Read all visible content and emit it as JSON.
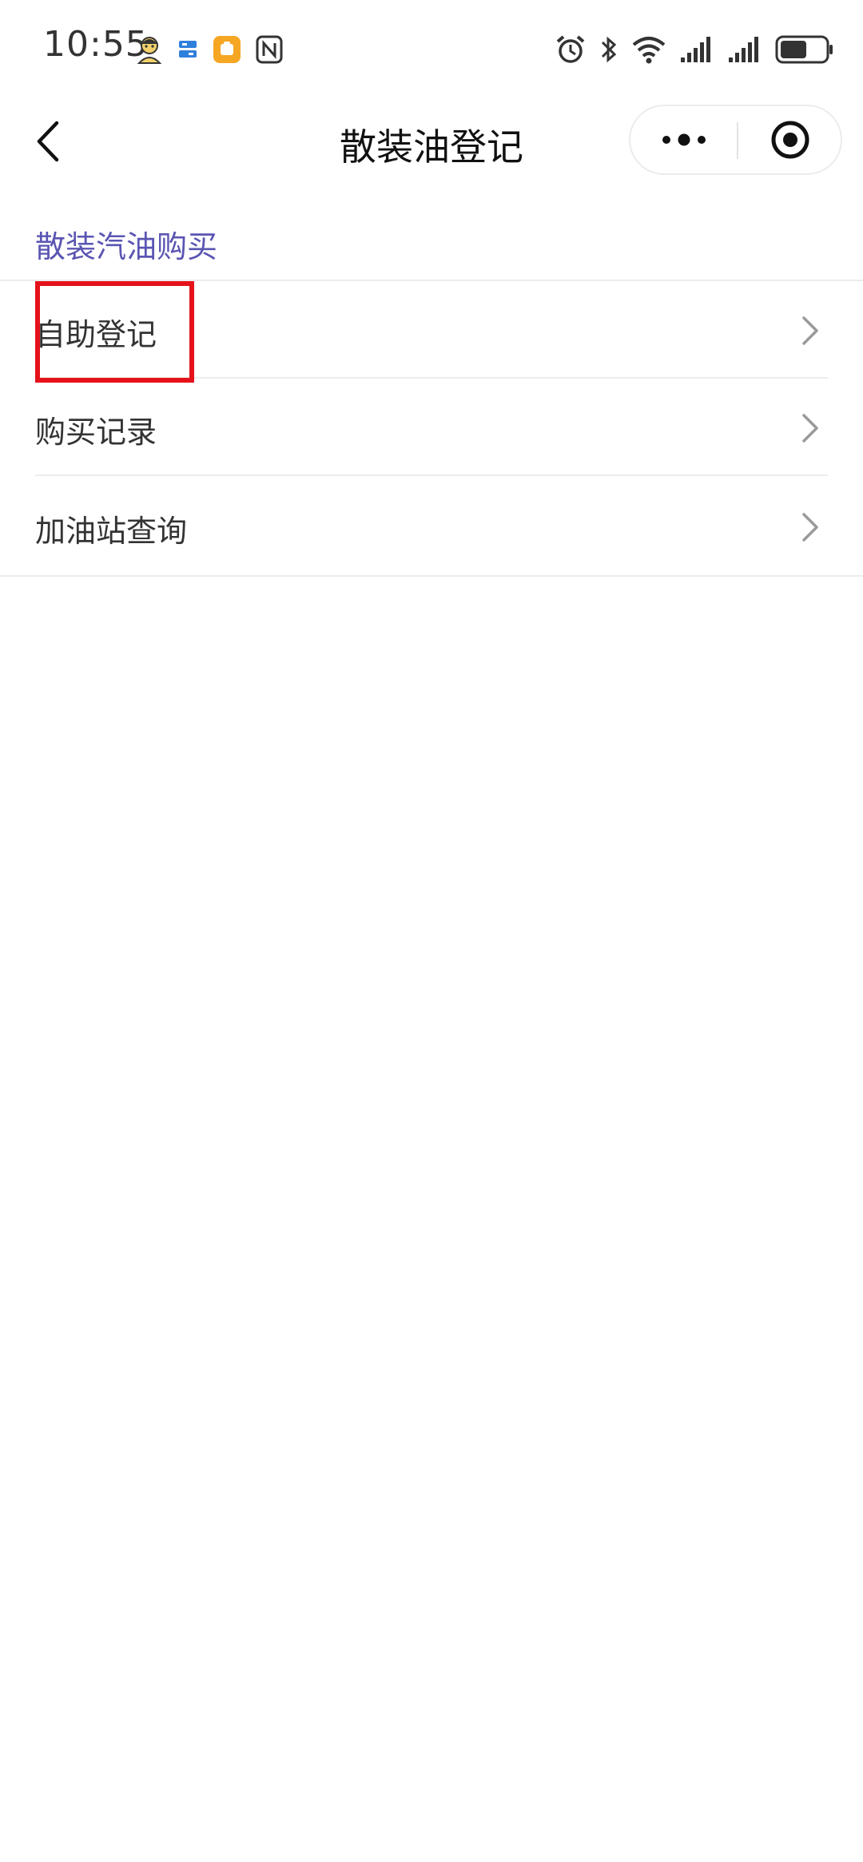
{
  "status_bar": {
    "time": "10:55",
    "left_icons": [
      "avatar-notification-icon",
      "message-app-icon",
      "mini-app-icon",
      "nfc-icon"
    ],
    "right_icons": [
      "alarm-icon",
      "bluetooth-icon",
      "wifi-icon",
      "cellular-signal-icon",
      "cellular-signal-icon",
      "battery-icon"
    ],
    "battery_level": 0.6
  },
  "nav_bar": {
    "title": "散装油登记",
    "back_icon": "chevron-left-icon",
    "more_icon": "more-dots-icon",
    "close_icon": "target-close-icon"
  },
  "section": {
    "title": "散装汽油购买"
  },
  "menu": {
    "items": [
      {
        "label": "自助登记",
        "icon": "chevron-right-icon",
        "highlighted": true
      },
      {
        "label": "购买记录",
        "icon": "chevron-right-icon",
        "highlighted": false
      },
      {
        "label": "加油站查询",
        "icon": "chevron-right-icon",
        "highlighted": false
      }
    ]
  },
  "colors": {
    "section_title": "#5a55b2",
    "highlight_border": "#e5121b",
    "divider": "#ececec",
    "text": "#333333"
  }
}
